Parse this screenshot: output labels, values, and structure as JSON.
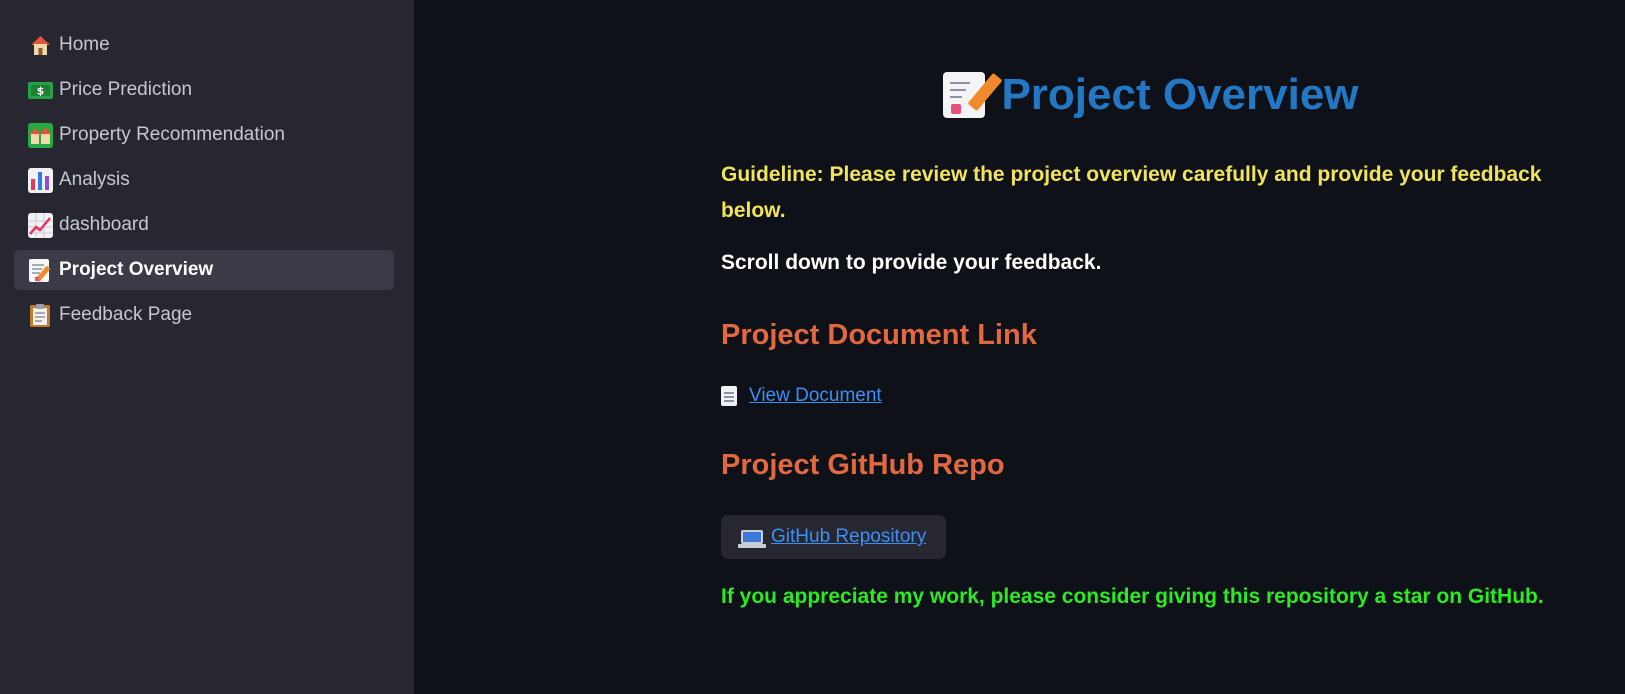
{
  "sidebar": {
    "items": [
      {
        "label": "Home",
        "icon": "house-icon",
        "active": false
      },
      {
        "label": "Price Prediction",
        "icon": "dollar-banknote-icon",
        "active": false
      },
      {
        "label": "Property Recommendation",
        "icon": "houses-icon",
        "active": false
      },
      {
        "label": "Analysis",
        "icon": "bar-chart-icon",
        "active": false
      },
      {
        "label": "dashboard",
        "icon": "chart-increasing-icon",
        "active": false
      },
      {
        "label": "Project Overview",
        "icon": "memo-icon",
        "active": true
      },
      {
        "label": "Feedback Page",
        "icon": "clipboard-icon",
        "active": false
      }
    ]
  },
  "main": {
    "title": "Project Overview",
    "guideline": "Guideline: Please review the project overview carefully and provide your feedback below.",
    "scroll_note": "Scroll down to provide your feedback.",
    "doc_heading": "Project Document Link",
    "doc_link": "View Document",
    "repo_heading": "Project GitHub Repo",
    "repo_button": "GitHub Repository",
    "star_note": "If you appreciate my work, please consider giving this repository a star on GitHub."
  },
  "colors": {
    "title": "#2278c4",
    "guideline": "#f1e35a",
    "heading": "#e2693f",
    "link": "#3c8ff4",
    "star_note": "#2bea22",
    "background": "#0e1117",
    "sidebar": "#262730"
  }
}
